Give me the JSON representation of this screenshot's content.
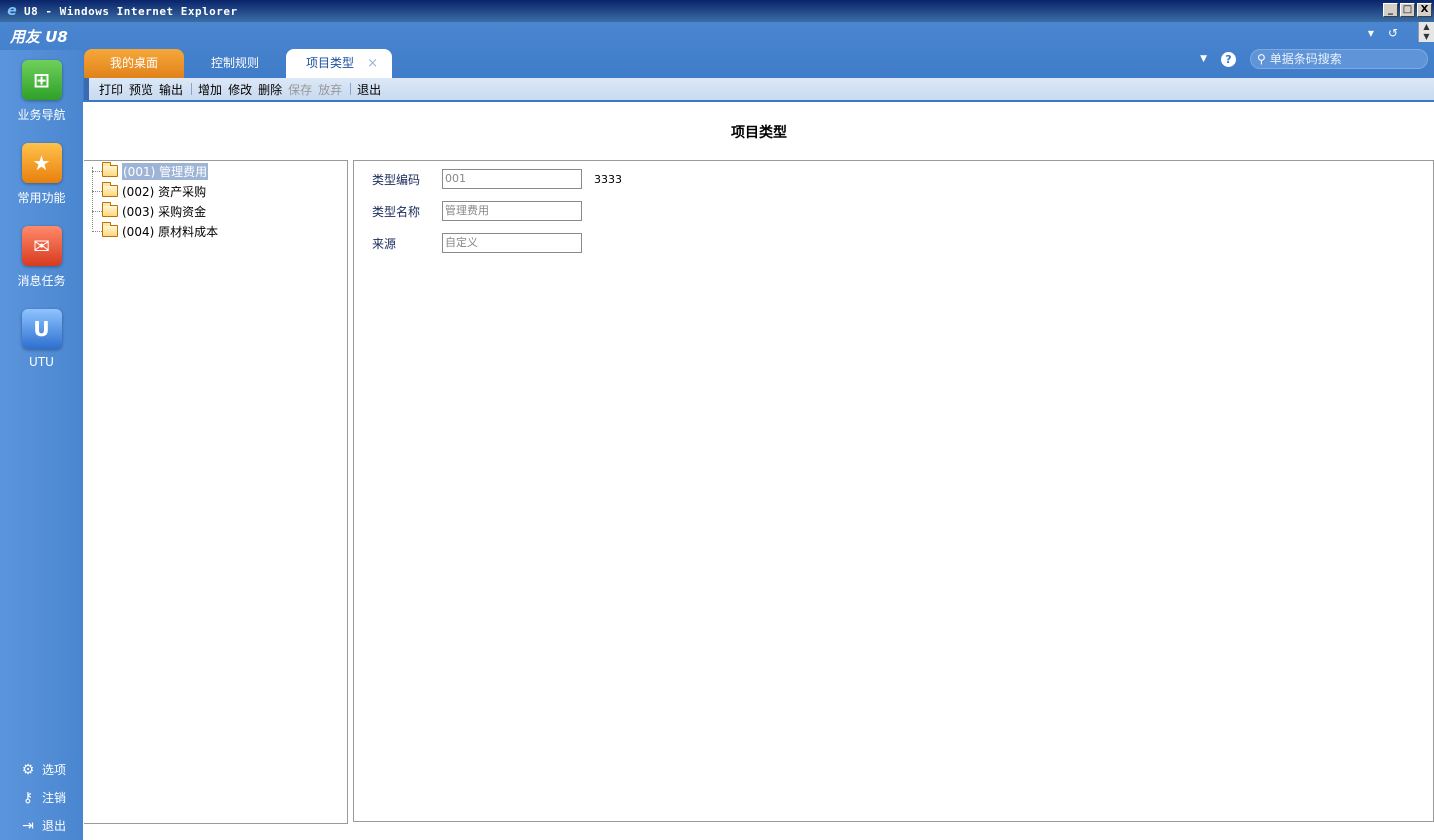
{
  "window": {
    "title": "U8 - Windows Internet Explorer",
    "buttons": [
      "_",
      "□",
      "X"
    ]
  },
  "app": {
    "brand": "用友 U8",
    "top_icons": [
      "▾",
      "↺"
    ]
  },
  "tabs": [
    {
      "label": "我的桌面"
    },
    {
      "label": "控制规则"
    },
    {
      "label": "项目类型",
      "close": "×"
    }
  ],
  "search": {
    "placeholder": "单据条码搜索"
  },
  "help": "?",
  "toolbar": {
    "group1": [
      "打印",
      "预览",
      "输出"
    ],
    "group2": [
      "增加",
      "修改",
      "删除"
    ],
    "disabled": [
      "保存",
      "放弃"
    ],
    "group3": [
      "退出"
    ]
  },
  "leftnav": {
    "items": [
      {
        "label": "业务导航",
        "icon": "tree-icon"
      },
      {
        "label": "常用功能",
        "icon": "star-icon"
      },
      {
        "label": "消息任务",
        "icon": "mail-icon"
      },
      {
        "label": "UTU",
        "icon": "utu-icon"
      }
    ],
    "bottom": [
      {
        "label": "选项",
        "icon": "⚙"
      },
      {
        "label": "注销",
        "icon": "⚷"
      },
      {
        "label": "退出",
        "icon": "⇥"
      }
    ]
  },
  "page": {
    "title": "项目类型"
  },
  "tree": {
    "items": [
      {
        "label": "(001) 管理费用",
        "selected": true
      },
      {
        "label": "(002) 资产采购"
      },
      {
        "label": "(003) 采购资金"
      },
      {
        "label": "(004) 原材料成本"
      }
    ]
  },
  "form": {
    "code_label": "类型编码",
    "code_value": "001",
    "code_extra": "3333",
    "name_label": "类型名称",
    "name_value": "管理费用",
    "source_label": "来源",
    "source_value": "自定义"
  }
}
